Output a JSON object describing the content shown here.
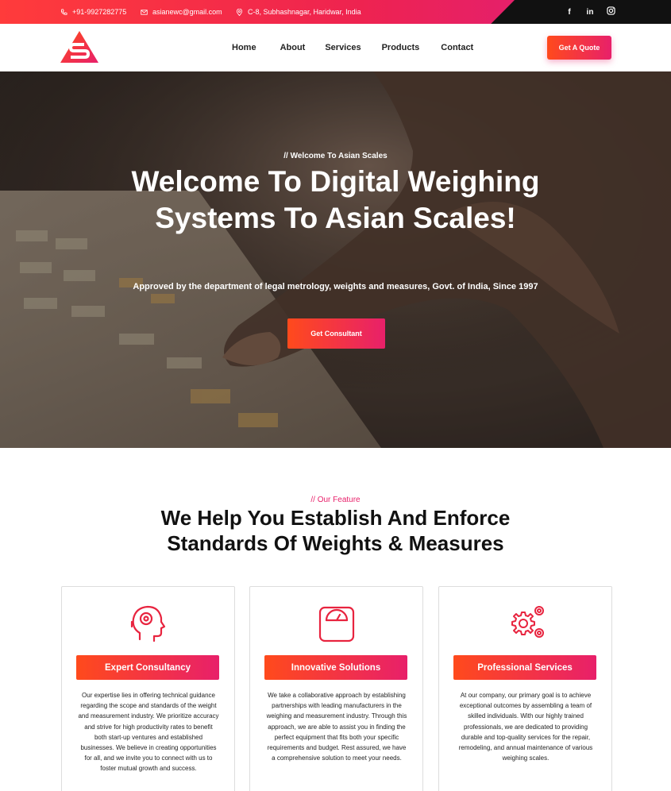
{
  "topbar": {
    "phone": "+91-9927282775",
    "email": "asianewc@gmail.com",
    "address": "C-8, Subhashnagar, Haridwar, India",
    "socials": [
      {
        "label": "f",
        "icon": "facebook-icon"
      },
      {
        "label": "in",
        "icon": "linkedin-icon"
      },
      {
        "label": "",
        "icon": "instagram-icon"
      }
    ]
  },
  "nav": {
    "items": [
      "Home",
      "About",
      "Services",
      "Products",
      "Contact"
    ],
    "cta": "Get A Quote"
  },
  "hero": {
    "kicker": "//  Welcome To Asian Scales",
    "title": "Welcome To Digital Weighing Systems To Asian Scales!",
    "subtitle": "Approved by the department of legal metrology, weights and measures, Govt. of India, Since 1997",
    "button": "Get Consultant"
  },
  "features": {
    "kicker": "//  Our Feature",
    "title": "We Help You Establish And Enforce Standards Of Weights & Measures",
    "cards": [
      {
        "icon": "consultant-head-icon",
        "button": "Expert Consultancy",
        "text": "Our expertise lies in offering technical guidance regarding the scope and standards of the weight and measurement industry. We prioritize accuracy and strive for high productivity rates to benefit both start-up ventures and established businesses. We believe in creating opportunities for all, and we invite you to connect with us to foster mutual growth and success."
      },
      {
        "icon": "weighing-scale-icon",
        "button": "Innovative Solutions",
        "text": "We take a collaborative approach by establishing partnerships with leading manufacturers in the weighing and measurement industry. Through this approach, we are able to assist you in finding the perfect equipment that fits both your specific requirements and budget. Rest assured, we have a comprehensive solution to meet your needs."
      },
      {
        "icon": "gears-icon",
        "button": "Professional Services",
        "text": "At our company, our primary goal is to achieve exceptional outcomes by assembling a team of skilled individuals. With our highly trained professionals, we are dedicated to providing durable and top-quality services for the repair, remodeling, and annual maintenance of various weighing scales."
      }
    ]
  },
  "colors": {
    "accent_start": "#ff4a1c",
    "accent_end": "#e8206a",
    "topbar_dark": "#111111"
  }
}
